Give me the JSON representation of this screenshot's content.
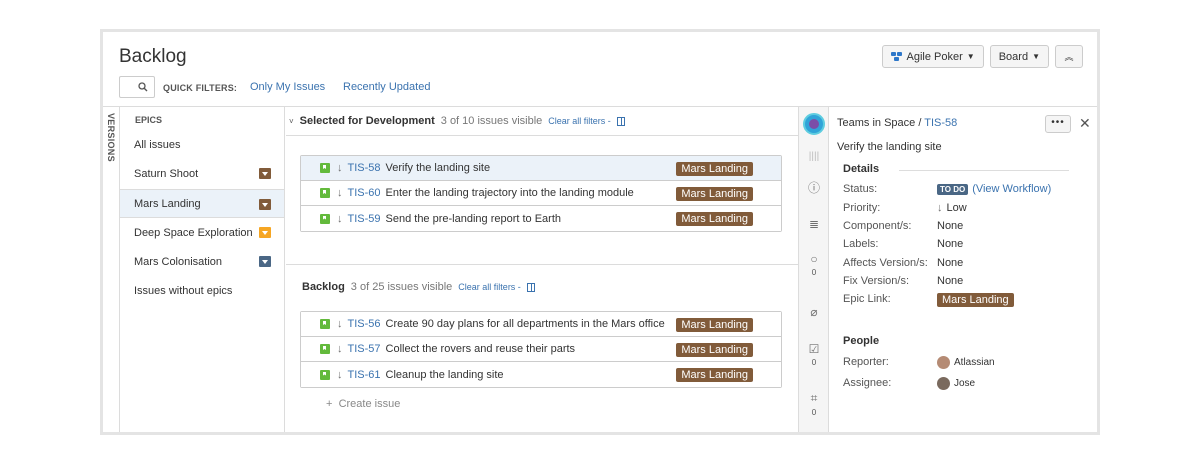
{
  "header": {
    "title": "Backlog",
    "agile_poker_label": "Agile Poker",
    "board_label": "Board"
  },
  "quick_filters": {
    "label": "QUICK FILTERS:",
    "items": [
      "Only My Issues",
      "Recently Updated"
    ]
  },
  "versions_tab": "VERSIONS",
  "epics": {
    "heading": "EPICS",
    "items": [
      {
        "label": "All issues",
        "color": ""
      },
      {
        "label": "Saturn Shoot",
        "color": "#815b3a"
      },
      {
        "label": "Mars Landing",
        "color": "#815b3a"
      },
      {
        "label": "Deep Space Exploration",
        "color": "#f6a623"
      },
      {
        "label": "Mars Colonisation",
        "color": "#4a6785"
      },
      {
        "label": "Issues without epics",
        "color": ""
      }
    ]
  },
  "sprint": {
    "title": "Selected for Development",
    "count": "3 of 10 issues visible",
    "clear": "Clear all filters -",
    "issues": [
      {
        "key": "TIS-58",
        "summary": "Verify the landing site",
        "epic": "Mars Landing"
      },
      {
        "key": "TIS-60",
        "summary": "Enter the landing trajectory into the landing module",
        "epic": "Mars Landing"
      },
      {
        "key": "TIS-59",
        "summary": "Send the pre-landing report to Earth",
        "epic": "Mars Landing"
      }
    ]
  },
  "backlog": {
    "title": "Backlog",
    "count": "3 of 25 issues visible",
    "clear": "Clear all filters -",
    "issues": [
      {
        "key": "TIS-56",
        "summary": "Create 90 day plans for all departments in the Mars office",
        "epic": "Mars Landing"
      },
      {
        "key": "TIS-57",
        "summary": "Collect the rovers and reuse their parts",
        "epic": "Mars Landing"
      },
      {
        "key": "TIS-61",
        "summary": "Cleanup the landing site",
        "epic": "Mars Landing"
      }
    ],
    "create_label": "Create issue"
  },
  "rail": {
    "comments_count": "0",
    "subtasks_count": "0",
    "screenshots_count": "0"
  },
  "detail": {
    "project": "Teams in Space",
    "separator": "/",
    "key": "TIS-58",
    "summary": "Verify the landing site",
    "details_heading": "Details",
    "status_label": "Status:",
    "status_value": "TO DO",
    "view_workflow": "(View Workflow)",
    "priority_label": "Priority:",
    "priority_value": "Low",
    "components_label": "Component/s:",
    "components_value": "None",
    "labels_label": "Labels:",
    "labels_value": "None",
    "affects_label": "Affects Version/s:",
    "affects_value": "None",
    "fix_label": "Fix Version/s:",
    "fix_value": "None",
    "epic_link_label": "Epic Link:",
    "epic_link_value": "Mars Landing",
    "people_heading": "People",
    "reporter_label": "Reporter:",
    "reporter_value": "Atlassian",
    "assignee_label": "Assignee:",
    "assignee_value": "Jose"
  }
}
